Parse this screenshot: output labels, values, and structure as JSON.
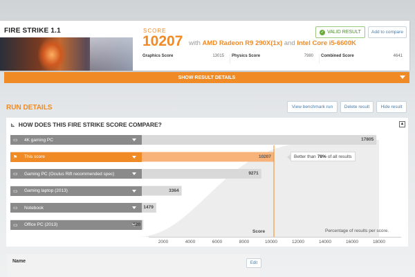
{
  "test": {
    "name": "FIRE STRIKE 1.1",
    "artwork": "fire-strike-artwork"
  },
  "score": {
    "label": "SCORE",
    "value": "10207",
    "with_text": "with",
    "gpu": "AMD Radeon R9 290X(1x)",
    "and_text": "and",
    "cpu": "Intel Core i5-6600K"
  },
  "actions": {
    "valid_result": "VALID RESULT",
    "add_to_compare": "Add to compare"
  },
  "subscores": [
    {
      "label": "Graphics Score",
      "value": "13015"
    },
    {
      "label": "Physics Score",
      "value": "7980"
    },
    {
      "label": "Combined Score",
      "value": "4641"
    }
  ],
  "show_details_label": "SHOW RESULT DETAILS",
  "run_details": {
    "title": "RUN DETAILS",
    "buttons": [
      "View benchmark run",
      "Delete result",
      "Hide result"
    ]
  },
  "compare": {
    "heading": "HOW DOES THIS FIRE STRIKE SCORE COMPARE?",
    "tooltip_prefix": "Better than",
    "tooltip_pct": "78%",
    "tooltip_suffix": "of all results",
    "score_axis_label": "Score",
    "pct_label": "Percentage of results per score."
  },
  "chart_data": {
    "type": "bar",
    "categories": [
      "4K gaming PC",
      "This score",
      "Gaming PC (Oculus Rift recommended spec)",
      "Gaming laptop (2013)",
      "Notebook",
      "Office PC (2013)"
    ],
    "values": [
      17805,
      10207,
      9271,
      3364,
      1479,
      520
    ],
    "highlight": "This score",
    "xticks": [
      2000,
      4000,
      6000,
      8000,
      10000,
      12000,
      14000,
      16000,
      18000
    ],
    "xlim": [
      0,
      18000
    ],
    "xlabel": "Score",
    "annotation": "Better than 78% of all results",
    "colors": {
      "bar": "#d9d9d9",
      "highlight": "#f7b37a",
      "label_bg": "#8a8a8a",
      "label_active": "#f08a24"
    }
  },
  "name_panel": {
    "label": "Name",
    "edit": "Edit"
  },
  "colors": {
    "accent": "#f08a24",
    "valid": "#6aab3a",
    "link": "#4a7aa8"
  }
}
